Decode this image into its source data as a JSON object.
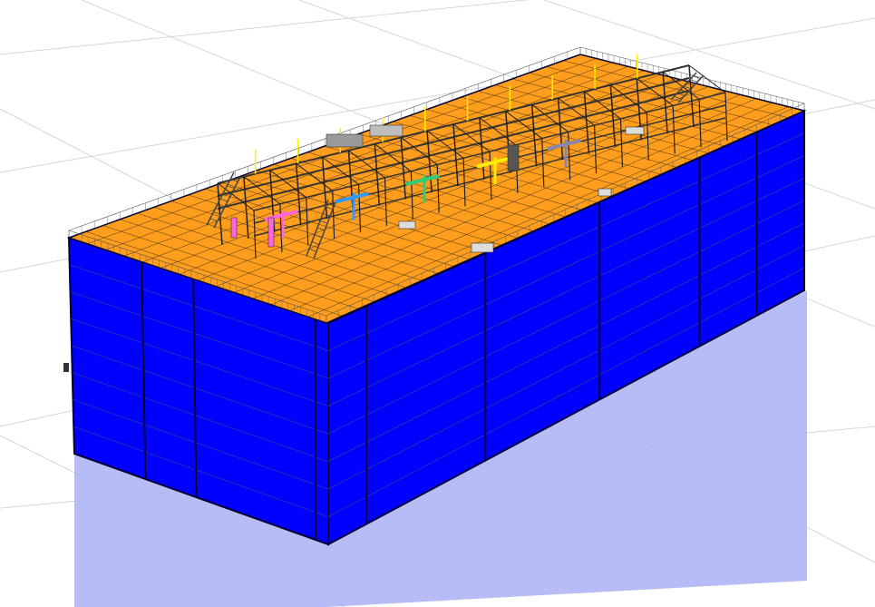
{
  "viewport": {
    "background": "#ffffff",
    "grid_color": "#d2d6df"
  },
  "model": {
    "hull_side_color": "#0000ff",
    "hull_edge_color": "#000033",
    "deck_color": "#ff9d1c",
    "deck_grid_color": "#1a1a1a",
    "structure_color": "#333333",
    "reflection_color": "#aab0f5",
    "accent_colors": [
      "#ff66dd",
      "#3399ff",
      "#33cc77",
      "#ffee00",
      "#8888aa"
    ]
  }
}
